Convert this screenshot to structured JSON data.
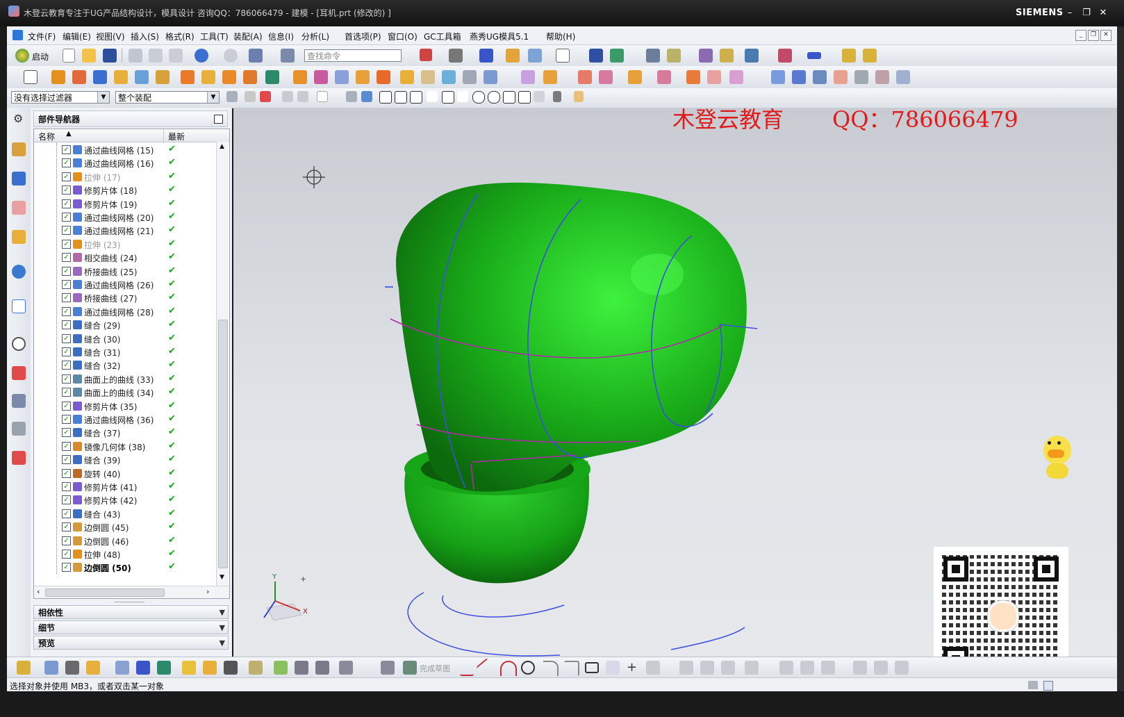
{
  "window": {
    "title": "木登云教育专注于UG产品结构设计，模具设计   咨询QQ：786066479 - 建模 - [耳机.prt  (修改的) ]",
    "brand": "SIEMENS",
    "controls": [
      "–",
      "❐",
      "✕"
    ]
  },
  "menubar": {
    "items": [
      "文件(F)",
      "编辑(E)",
      "视图(V)",
      "插入(S)",
      "格式(R)",
      "工具(T)",
      "装配(A)",
      "信息(I)",
      "分析(L)",
      "首选项(P)",
      "窗口(O)",
      "GC工具箱",
      "燕秀UG模具5.1",
      "帮助(H)"
    ]
  },
  "toolbar": {
    "start_label": "启动",
    "search_placeholder": "查找命令",
    "filter_value": "没有选择过滤器",
    "scope_value": "整个装配"
  },
  "navigator": {
    "title": "部件导航器",
    "col_name": "名称",
    "col_latest": "最新",
    "items": [
      {
        "name": "通过曲线网格 (15)",
        "color": "#4a7fd6",
        "state": "normal"
      },
      {
        "name": "通过曲线网格 (16)",
        "color": "#4a7fd6",
        "state": "normal"
      },
      {
        "name": "拉伸 (17)",
        "color": "#e3901c",
        "state": "dim"
      },
      {
        "name": "修剪片体 (18)",
        "color": "#7b5bd0",
        "state": "normal"
      },
      {
        "name": "修剪片体 (19)",
        "color": "#7b5bd0",
        "state": "normal"
      },
      {
        "name": "通过曲线网格 (20)",
        "color": "#4a7fd6",
        "state": "normal"
      },
      {
        "name": "通过曲线网格 (21)",
        "color": "#4a7fd6",
        "state": "normal"
      },
      {
        "name": "拉伸 (23)",
        "color": "#e3901c",
        "state": "dim"
      },
      {
        "name": "相交曲线 (24)",
        "color": "#b06aa8",
        "state": "normal"
      },
      {
        "name": "桥接曲线 (25)",
        "color": "#9a6ac0",
        "state": "normal"
      },
      {
        "name": "通过曲线网格 (26)",
        "color": "#4a7fd6",
        "state": "normal"
      },
      {
        "name": "桥接曲线 (27)",
        "color": "#9a6ac0",
        "state": "normal"
      },
      {
        "name": "通过曲线网格 (28)",
        "color": "#4a7fd6",
        "state": "normal"
      },
      {
        "name": "缝合 (29)",
        "color": "#3b6fc4",
        "state": "normal"
      },
      {
        "name": "缝合 (30)",
        "color": "#3b6fc4",
        "state": "normal"
      },
      {
        "name": "缝合 (31)",
        "color": "#3b6fc4",
        "state": "normal"
      },
      {
        "name": "缝合 (32)",
        "color": "#3b6fc4",
        "state": "normal"
      },
      {
        "name": "曲面上的曲线 (33)",
        "color": "#5a8aa6",
        "state": "normal"
      },
      {
        "name": "曲面上的曲线 (34)",
        "color": "#5a8aa6",
        "state": "normal"
      },
      {
        "name": "修剪片体 (35)",
        "color": "#7b5bd0",
        "state": "normal"
      },
      {
        "name": "通过曲线网格 (36)",
        "color": "#4a7fd6",
        "state": "normal"
      },
      {
        "name": "缝合 (37)",
        "color": "#3b6fc4",
        "state": "normal"
      },
      {
        "name": "镜像几何体 (38)",
        "color": "#d68a2a",
        "state": "normal"
      },
      {
        "name": "缝合 (39)",
        "color": "#3b6fc4",
        "state": "normal"
      },
      {
        "name": "旋转 (40)",
        "color": "#c06a2a",
        "state": "normal"
      },
      {
        "name": "修剪片体 (41)",
        "color": "#7b5bd0",
        "state": "normal"
      },
      {
        "name": "修剪片体 (42)",
        "color": "#7b5bd0",
        "state": "normal"
      },
      {
        "name": "缝合 (43)",
        "color": "#3b6fc4",
        "state": "normal"
      },
      {
        "name": "边倒圆 (45)",
        "color": "#d49a3a",
        "state": "normal"
      },
      {
        "name": "边倒圆 (46)",
        "color": "#d49a3a",
        "state": "normal"
      },
      {
        "name": "拉伸 (48)",
        "color": "#e3901c",
        "state": "normal"
      },
      {
        "name": "边倒圆 (50)",
        "color": "#d49a3a",
        "state": "bold"
      }
    ],
    "accordions": [
      "相依性",
      "细节",
      "预览"
    ]
  },
  "viewport": {
    "watermark_left": "木登云教育",
    "watermark_right": "QQ：786066479",
    "model_color": "#1fa51f",
    "axis_y": "Y",
    "axis_x": "X",
    "axis_plus": "+"
  },
  "bottom_toolbar": {
    "sketch_finish_label": "完成草图"
  },
  "status": {
    "text": "选择对象并使用 MB3，或者双击某一对象"
  }
}
